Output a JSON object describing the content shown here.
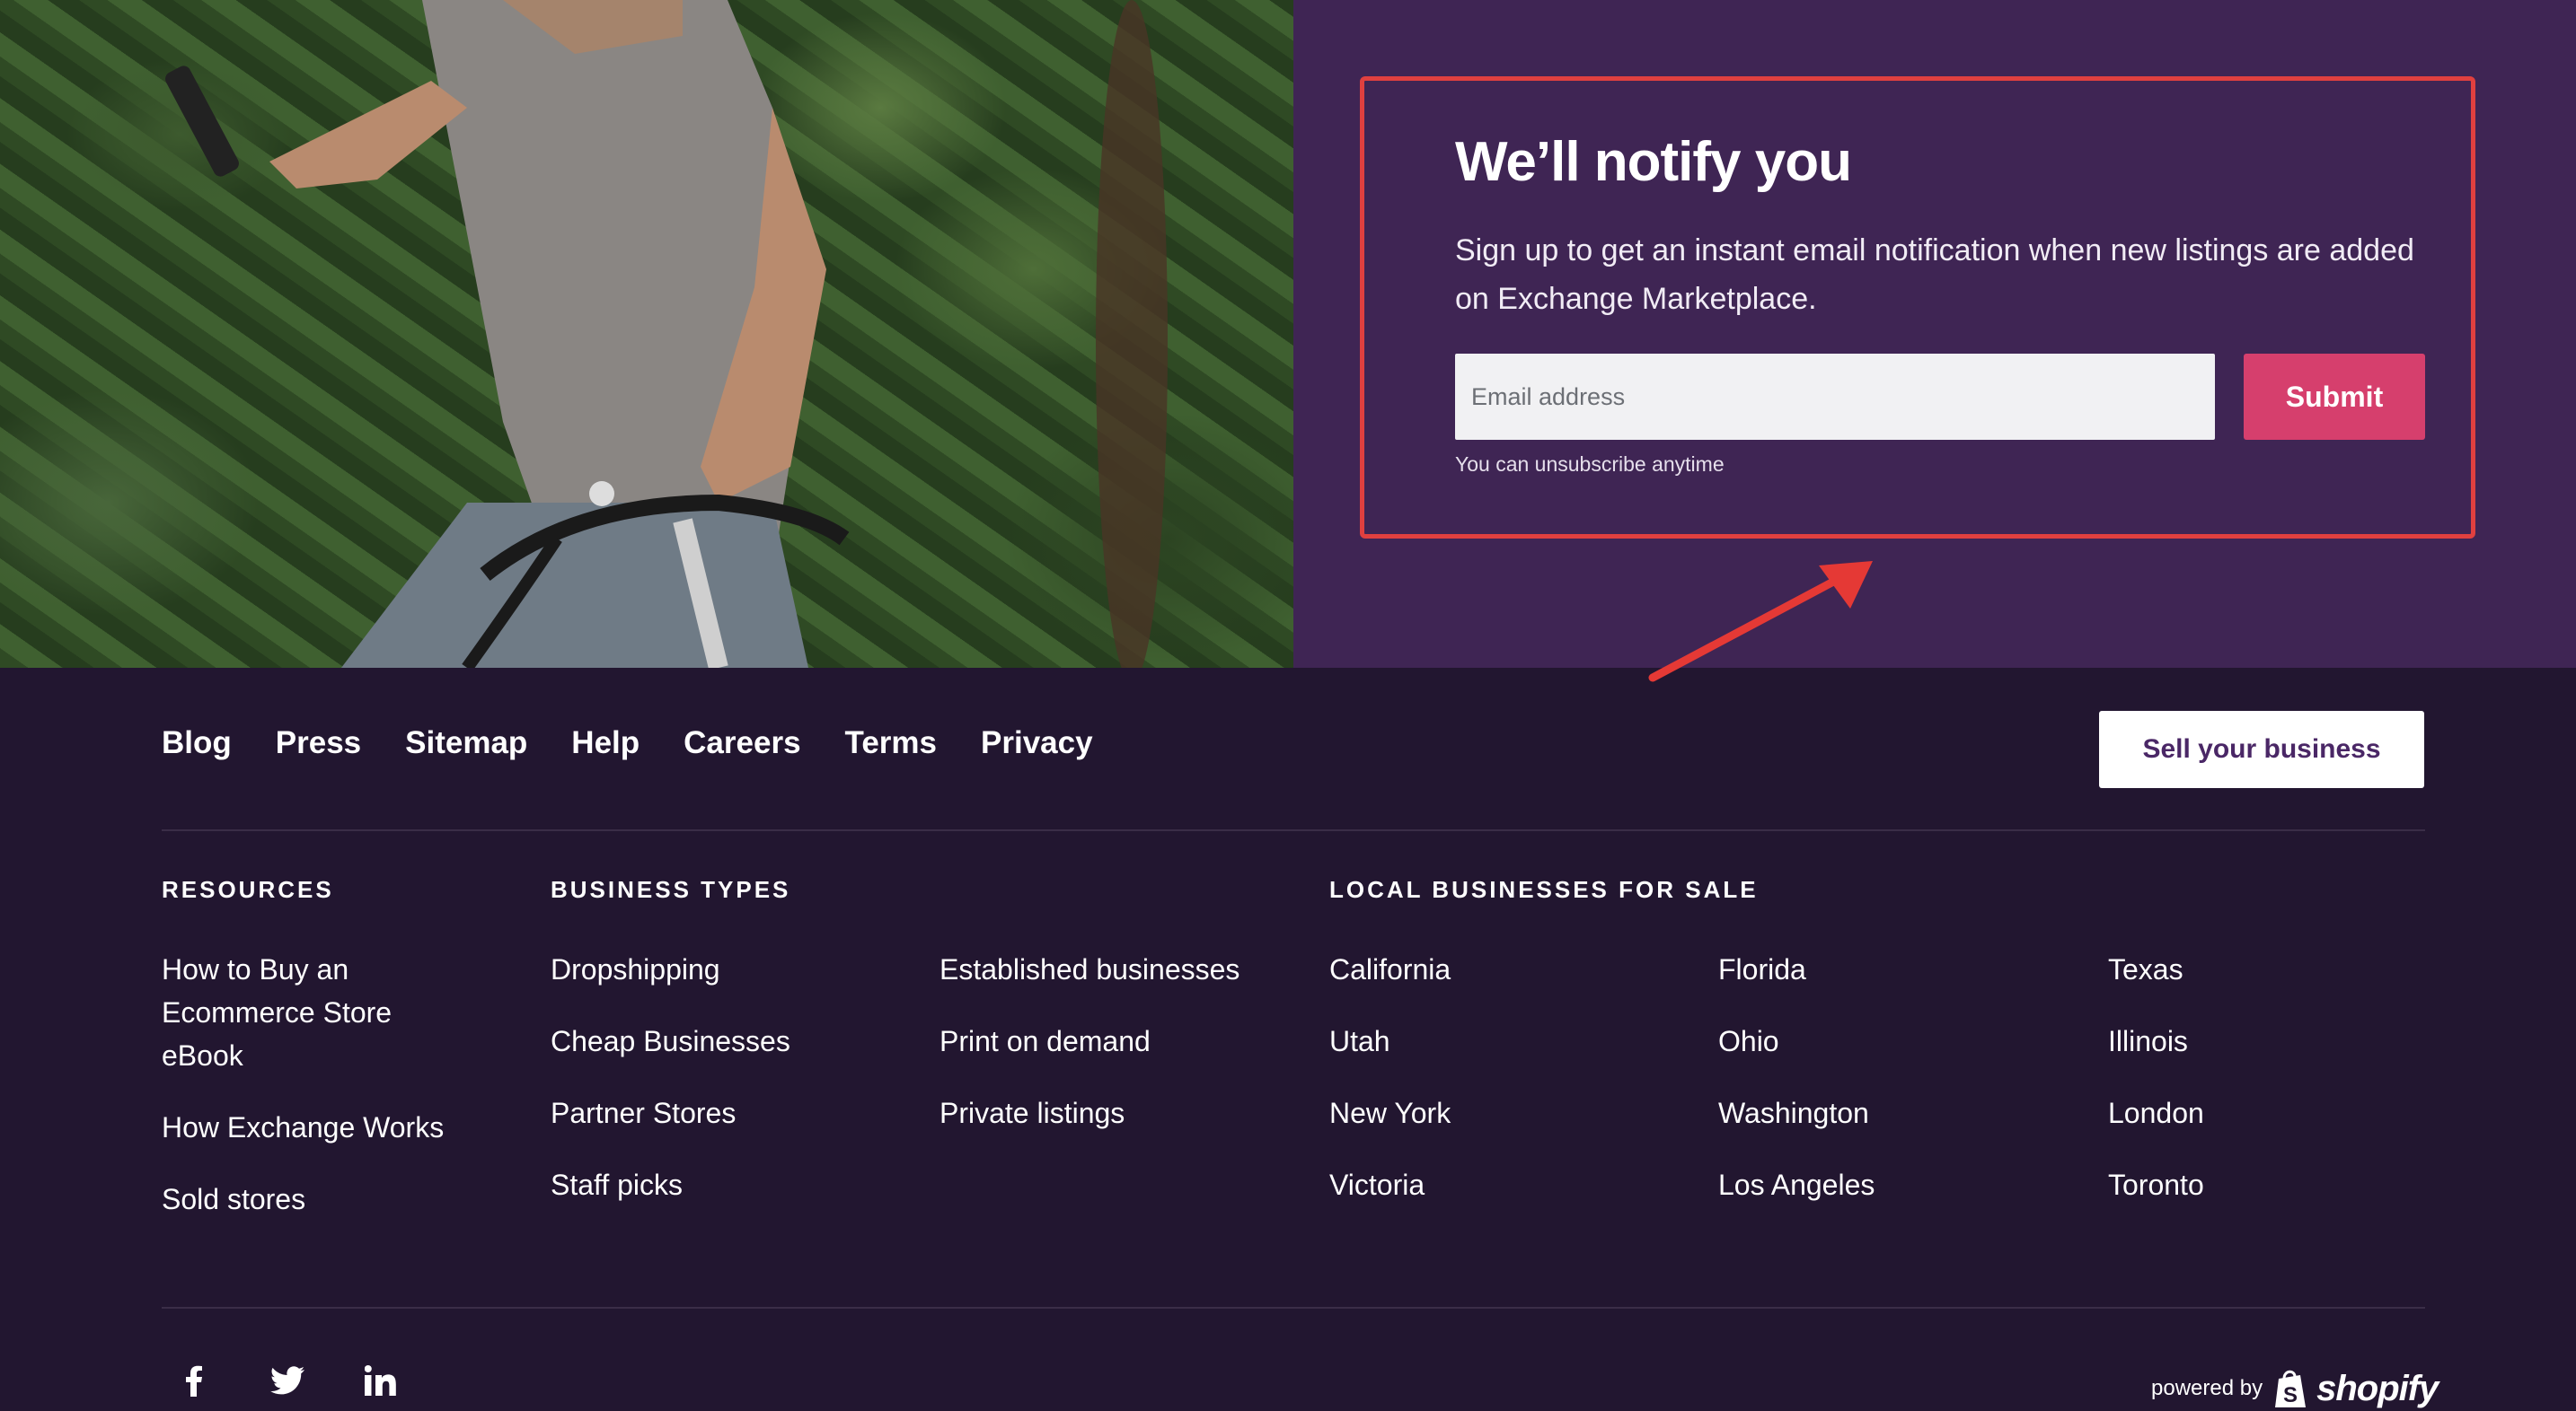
{
  "notify": {
    "title": "We’ll notify you",
    "description": "Sign up to get an instant email notification when new listings are added on Exchange Marketplace.",
    "email_placeholder": "Email address",
    "email_value": "",
    "submit_label": "Submit",
    "unsubscribe_note": "You can unsubscribe anytime"
  },
  "footer": {
    "nav": [
      "Blog",
      "Press",
      "Sitemap",
      "Help",
      "Careers",
      "Terms",
      "Privacy"
    ],
    "sell_button": "Sell your business",
    "resources": {
      "heading": "RESOURCES",
      "items": [
        "How to Buy an Ecommerce Store eBook",
        "How Exchange Works",
        "Sold stores"
      ]
    },
    "business_types": {
      "heading": "BUSINESS TYPES",
      "col1": [
        "Dropshipping",
        "Cheap Businesses",
        "Partner Stores",
        "Staff picks"
      ],
      "col2": [
        "Established businesses",
        "Print on demand",
        "Private listings"
      ]
    },
    "local": {
      "heading": "LOCAL BUSINESSES FOR SALE",
      "col1": [
        "California",
        "Utah",
        "New York",
        "Victoria"
      ],
      "col2": [
        "Florida",
        "Ohio",
        "Washington",
        "Los Angeles"
      ],
      "col3": [
        "Texas",
        "Illinois",
        "London",
        "Toronto"
      ]
    },
    "social_icons": [
      "facebook-icon",
      "twitter-icon",
      "linkedin-icon"
    ],
    "powered_by": "powered by",
    "brand": "shopify"
  },
  "colors": {
    "hero_purple": "#3f2554",
    "footer_bg": "#221630",
    "submit_pink": "#d63f6d",
    "annotation_red": "#e0403f"
  }
}
